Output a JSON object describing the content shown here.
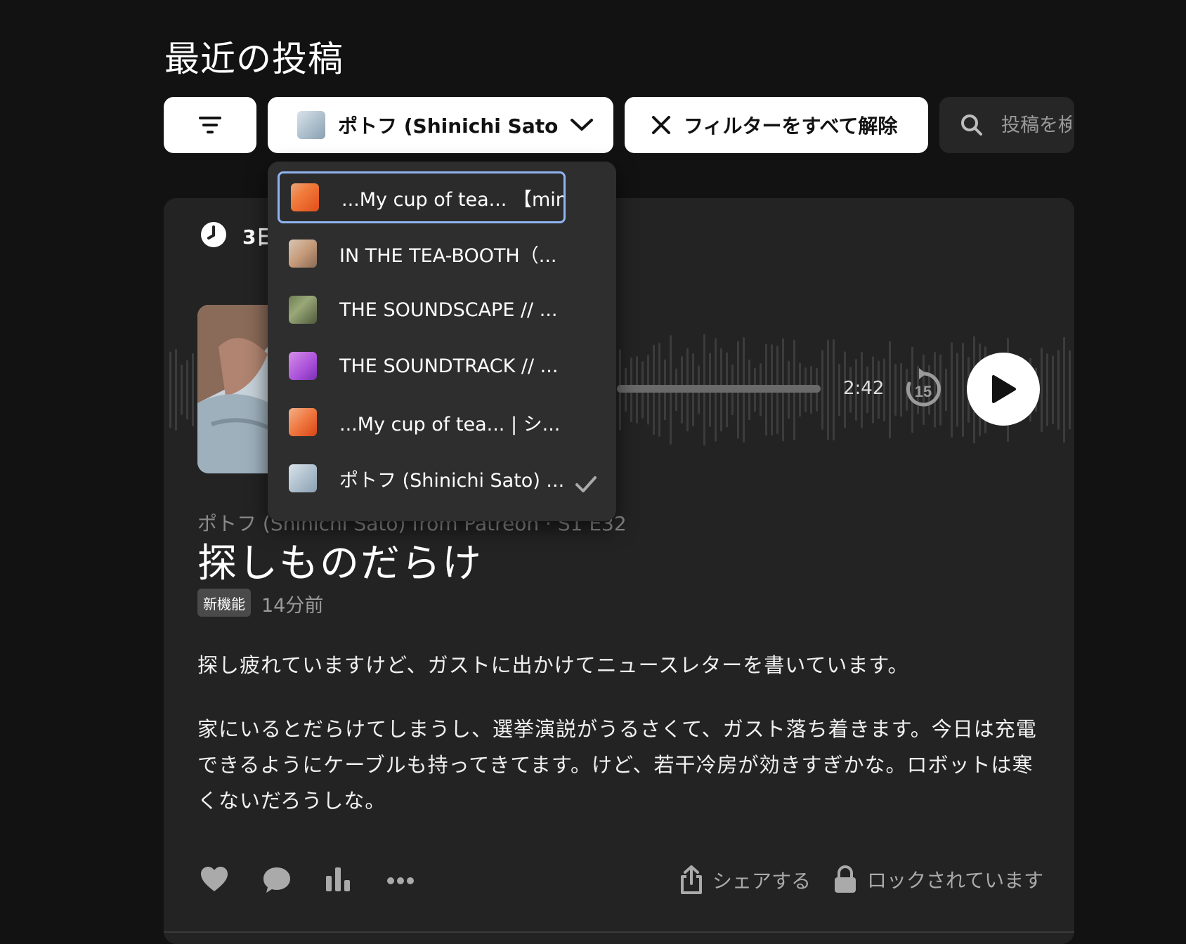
{
  "header": {
    "title": "最近の投稿"
  },
  "filters": {
    "creator_select": {
      "label": "ポトフ (Shinichi Sato)..."
    },
    "clear_all_label": "フィルターをすべて解除",
    "search_placeholder": "投稿を検索"
  },
  "dropdown": {
    "items": [
      {
        "label": "...My cup of tea... 【mini】",
        "thumb_color": "#f07a3a",
        "focused": true,
        "selected": false
      },
      {
        "label": "IN THE TEA-BOOTH（...",
        "thumb_color": "#c69b7a",
        "focused": false,
        "selected": false
      },
      {
        "label": "THE SOUNDSCAPE // ...",
        "thumb_color": "#9aa878",
        "focused": false,
        "selected": false
      },
      {
        "label": "THE SOUNDTRACK // ...",
        "thumb_color": "#a950d9",
        "focused": false,
        "selected": false
      },
      {
        "label": "...My cup of tea... | シ...",
        "thumb_color": "#ef7740",
        "focused": false,
        "selected": false
      },
      {
        "label": "ポトフ (Shinichi Sato) ...",
        "thumb_color": "#b8c8d4",
        "focused": false,
        "selected": true
      }
    ]
  },
  "post": {
    "time_ago_top": "3日",
    "player": {
      "duration": "2:42",
      "skip_seconds": "15"
    },
    "subtitle": "ポトフ (Shinichi Sato) from Patreon · S1 E32",
    "title": "探しものだらけ",
    "badge": "新機能",
    "posted_ago": "14分前",
    "body": [
      "探し疲れていますけど、ガストに出かけてニュースレターを書いています。",
      "家にいるとだらけてしまうし、選挙演説がうるさくて、ガスト落ち着きます。今日は充電できるようにケーブルも持ってきてます。けど、若干冷房が効きすぎかな。ロボットは寒くないだろうしな。"
    ],
    "actions": {
      "share_label": "シェアする",
      "locked_label": "ロックされています"
    }
  }
}
